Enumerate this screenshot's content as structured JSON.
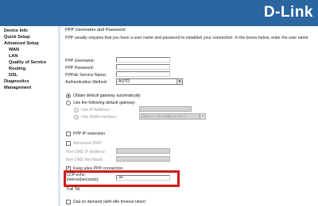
{
  "brand": {
    "logo": "D-Link"
  },
  "sidebar": {
    "items": [
      {
        "label": "Device Info"
      },
      {
        "label": "Quick Setup"
      },
      {
        "label": "Advanced Setup"
      },
      {
        "label": "WAN"
      },
      {
        "label": "LAN"
      },
      {
        "label": "Quality of Service"
      },
      {
        "label": "Routing"
      },
      {
        "label": "DSL"
      },
      {
        "label": "Diagnostics"
      },
      {
        "label": "Management"
      }
    ]
  },
  "main": {
    "title": "PPP Username and Password",
    "description": "PPP usually requires that you have a user name and password to establish your connection. In the boxes below, enter the user name",
    "fields": {
      "username_label": "PPP Username:",
      "password_label": "PPP Password:",
      "service_label": "PPPoE Service Name:",
      "auth_label": "Authentication Method:",
      "auth_value": "AUTO"
    },
    "gateway": {
      "auto_label": "Obtain default gateway automatically",
      "manual_label": "Use the following default gateway:",
      "ip_label": "Use IP Address:",
      "wan_label": "Use WAN Interface:",
      "wan_value": "pppoe_0_35_1/ppp_0_35_1"
    },
    "ppp_ip_ext_label": "PPP IP extension",
    "dmz": {
      "advanced_label": "Advanced DMZ",
      "nondmz_ip_label": "Non DMZ IP Address:",
      "nondmz_mask_label": "Non DMZ Net Mask:"
    },
    "keepalive": {
      "label": "Keep alive PPP connection",
      "lcp_label_line1": "LCP echo",
      "lcp_label_line2": "interval(seconds):",
      "lcp_value": "30",
      "fail_label": "Fail Tal"
    },
    "dial_on_demand_label": "Dial on demand (with idle timeout timer)"
  },
  "colors": {
    "header": "#2b66a0",
    "highlight": "#cc1b1b"
  }
}
